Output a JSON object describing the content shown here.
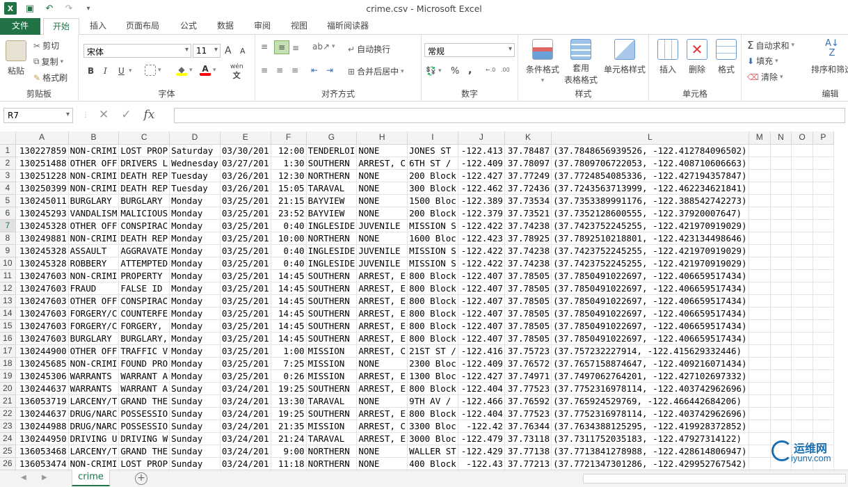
{
  "window": {
    "title": "crime.csv - Microsoft Excel"
  },
  "qat": {
    "logo": "X",
    "icons": [
      "save-icon",
      "undo-icon",
      "redo-icon",
      "customize-icon"
    ]
  },
  "tabs": [
    {
      "label": "文件"
    },
    {
      "label": "开始"
    },
    {
      "label": "插入"
    },
    {
      "label": "页面布局"
    },
    {
      "label": "公式"
    },
    {
      "label": "数据"
    },
    {
      "label": "审阅"
    },
    {
      "label": "视图"
    },
    {
      "label": "福昕阅读器"
    }
  ],
  "ribbon": {
    "clipboard": {
      "label": "剪贴板",
      "paste": "粘贴",
      "cut": "剪切",
      "copy": "复制",
      "format_painter": "格式刷"
    },
    "font": {
      "label": "字体",
      "font_name": "宋体",
      "font_size": "11",
      "grow": "A",
      "shrink": "A",
      "bold": "B",
      "italic": "I",
      "underline": "U",
      "phonetic": "wén"
    },
    "alignment": {
      "label": "对齐方式",
      "wrap": "自动换行",
      "merge": "合并后居中"
    },
    "number": {
      "label": "数字",
      "format": "常规",
      "percent": "%",
      "comma": ","
    },
    "styles": {
      "label": "样式",
      "conditional": "条件格式",
      "table_line1": "套用",
      "table_line2": "表格格式",
      "cell_styles": "单元格样式"
    },
    "cells": {
      "label": "单元格",
      "insert": "插入",
      "delete": "删除",
      "format": "格式"
    },
    "editing": {
      "label": "编辑",
      "autosum": "自动求和",
      "fill": "填充",
      "clear": "清除",
      "sort": "排序和筛选"
    }
  },
  "formula_bar": {
    "name_box": "R7",
    "fx": "fx",
    "value": ""
  },
  "columns": [
    "A",
    "B",
    "C",
    "D",
    "E",
    "F",
    "G",
    "H",
    "I",
    "J",
    "K",
    "L",
    "M",
    "N",
    "O",
    "P"
  ],
  "rows": [
    [
      "1",
      "130227859",
      "NON-CRIMI",
      "LOST PROP",
      "Saturday",
      "03/30/201",
      "12:00",
      "TENDERLOI",
      "NONE",
      "JONES ST",
      "-122.413",
      "37.78487",
      "(37.7848656939526, -122.412784096502)"
    ],
    [
      "2",
      "130251488",
      "OTHER OFF",
      "DRIVERS L",
      "Wednesday",
      "03/27/201",
      "1:30",
      "SOUTHERN",
      "ARREST, C",
      "6TH ST /",
      "-122.409",
      "37.78097",
      "(37.7809706722053, -122.408710606663)"
    ],
    [
      "3",
      "130251228",
      "NON-CRIMI",
      "DEATH REP",
      "Tuesday",
      "03/26/201",
      "12:30",
      "NORTHERN",
      "NONE",
      "200 Block",
      "-122.427",
      "37.77249",
      "(37.7724854085336, -122.427194357847)"
    ],
    [
      "4",
      "130250399",
      "NON-CRIMI",
      "DEATH REP",
      "Tuesday",
      "03/26/201",
      "15:05",
      "TARAVAL",
      "NONE",
      "300 Block",
      "-122.462",
      "37.72436",
      "(37.7243563713999, -122.462234621841)"
    ],
    [
      "5",
      "130245011",
      "BURGLARY",
      "BURGLARY",
      "Monday",
      "03/25/201",
      "21:15",
      "BAYVIEW",
      "NONE",
      "1500 Bloc",
      "-122.389",
      "37.73534",
      "(37.7353389991176, -122.388542742273)"
    ],
    [
      "6",
      "130245293",
      "VANDALISM",
      "MALICIOUS",
      "Monday",
      "03/25/201",
      "23:52",
      "BAYVIEW",
      "NONE",
      "200 Block",
      "-122.379",
      "37.73521",
      "(37.7352128600555, -122.37920007647)"
    ],
    [
      "7",
      "130245328",
      "OTHER OFF",
      "CONSPIRAC",
      "Monday",
      "03/25/201",
      "0:40",
      "INGLESIDE",
      "JUVENILE",
      "MISSION S",
      "-122.422",
      "37.74238",
      "(37.7423752245255, -122.421970919029)"
    ],
    [
      "8",
      "130249881",
      "NON-CRIMI",
      "DEATH REP",
      "Monday",
      "03/25/201",
      "10:00",
      "NORTHERN",
      "NONE",
      "1600 Bloc",
      "-122.423",
      "37.78925",
      "(37.7892510218801, -122.423134498646)"
    ],
    [
      "9",
      "130245328",
      "ASSAULT",
      "AGGRAVATE",
      "Monday",
      "03/25/201",
      "0:40",
      "INGLESIDE",
      "JUVENILE",
      "MISSION S",
      "-122.422",
      "37.74238",
      "(37.7423752245255, -122.421970919029)"
    ],
    [
      "10",
      "130245328",
      "ROBBERY",
      "ATTEMPTED",
      "Monday",
      "03/25/201",
      "0:40",
      "INGLESIDE",
      "JUVENILE",
      "MISSION S",
      "-122.422",
      "37.74238",
      "(37.7423752245255, -122.421970919029)"
    ],
    [
      "11",
      "130247603",
      "NON-CRIMI",
      "PROPERTY",
      "Monday",
      "03/25/201",
      "14:45",
      "SOUTHERN",
      "ARREST, E",
      "800 Block",
      "-122.407",
      "37.78505",
      "(37.7850491022697, -122.406659517434)"
    ],
    [
      "12",
      "130247603",
      "FRAUD",
      "FALSE ID",
      "Monday",
      "03/25/201",
      "14:45",
      "SOUTHERN",
      "ARREST, E",
      "800 Block",
      "-122.407",
      "37.78505",
      "(37.7850491022697, -122.406659517434)"
    ],
    [
      "13",
      "130247603",
      "OTHER OFF",
      "CONSPIRAC",
      "Monday",
      "03/25/201",
      "14:45",
      "SOUTHERN",
      "ARREST, E",
      "800 Block",
      "-122.407",
      "37.78505",
      "(37.7850491022697, -122.406659517434)"
    ],
    [
      "14",
      "130247603",
      "FORGERY/C",
      "COUNTERFE",
      "Monday",
      "03/25/201",
      "14:45",
      "SOUTHERN",
      "ARREST, E",
      "800 Block",
      "-122.407",
      "37.78505",
      "(37.7850491022697, -122.406659517434)"
    ],
    [
      "15",
      "130247603",
      "FORGERY/C",
      "FORGERY,",
      "Monday",
      "03/25/201",
      "14:45",
      "SOUTHERN",
      "ARREST, E",
      "800 Block",
      "-122.407",
      "37.78505",
      "(37.7850491022697, -122.406659517434)"
    ],
    [
      "16",
      "130247603",
      "BURGLARY",
      "BURGLARY,",
      "Monday",
      "03/25/201",
      "14:45",
      "SOUTHERN",
      "ARREST, E",
      "800 Block",
      "-122.407",
      "37.78505",
      "(37.7850491022697, -122.406659517434)"
    ],
    [
      "17",
      "130244900",
      "OTHER OFF",
      "TRAFFIC V",
      "Monday",
      "03/25/201",
      "1:00",
      "MISSION",
      "ARREST, C",
      "21ST ST /",
      "-122.416",
      "37.75723",
      "(37.757232227914, -122.415629332446)"
    ],
    [
      "18",
      "130245685",
      "NON-CRIMI",
      "FOUND PRO",
      "Monday",
      "03/25/201",
      "7:25",
      "MISSION",
      "NONE",
      "2300 Bloc",
      "-122.409",
      "37.76572",
      "(37.7657158874647, -122.409216071434)"
    ],
    [
      "19",
      "130245306",
      "WARRANTS",
      "WARRANT A",
      "Monday",
      "03/25/201",
      "0:26",
      "MISSION",
      "ARREST, E",
      "1300 Bloc",
      "-122.427",
      "37.74971",
      "(37.7497062764201, -122.427102697332)"
    ],
    [
      "20",
      "130244637",
      "WARRANTS",
      "WARRANT A",
      "Sunday",
      "03/24/201",
      "19:25",
      "SOUTHERN",
      "ARREST, E",
      "800 Block",
      "-122.404",
      "37.77523",
      "(37.7752316978114, -122.403742962696)"
    ],
    [
      "21",
      "136053719",
      "LARCENY/T",
      "GRAND THE",
      "Sunday",
      "03/24/201",
      "13:30",
      "TARAVAL",
      "NONE",
      "9TH AV /",
      "-122.466",
      "37.76592",
      "(37.765924529769, -122.466442684206)"
    ],
    [
      "22",
      "130244637",
      "DRUG/NARC",
      "POSSESSIO",
      "Sunday",
      "03/24/201",
      "19:25",
      "SOUTHERN",
      "ARREST, E",
      "800 Block",
      "-122.404",
      "37.77523",
      "(37.7752316978114, -122.403742962696)"
    ],
    [
      "23",
      "130244988",
      "DRUG/NARC",
      "POSSESSIO",
      "Sunday",
      "03/24/201",
      "21:35",
      "MISSION",
      "ARREST, C",
      "3300 Bloc",
      "-122.42",
      "37.76344",
      "(37.7634388125295, -122.419928372852)"
    ],
    [
      "24",
      "130244950",
      "DRIVING U",
      "DRIVING W",
      "Sunday",
      "03/24/201",
      "21:24",
      "TARAVAL",
      "ARREST, E",
      "3000 Bloc",
      "-122.479",
      "37.73118",
      "(37.7311752035183, -122.47927314122)"
    ],
    [
      "25",
      "136053468",
      "LARCENY/T",
      "GRAND THE",
      "Sunday",
      "03/24/201",
      "9:00",
      "NORTHERN",
      "NONE",
      "WALLER ST",
      "-122.429",
      "37.77138",
      "(37.7713841278988, -122.428614806947)"
    ],
    [
      "26",
      "136053474",
      "NON-CRIMI",
      "LOST PROP",
      "Sunday",
      "03/24/201",
      "11:18",
      "NORTHERN",
      "NONE",
      "400 Block",
      "-122.43",
      "37.77213",
      "(37.7721347301286, -122.429952767542)"
    ]
  ],
  "sheet_tabs": [
    {
      "label": "crime"
    }
  ],
  "watermark": {
    "line1": "运维网",
    "line2": "iyunv.com"
  },
  "colors": {
    "accent": "#217346"
  }
}
